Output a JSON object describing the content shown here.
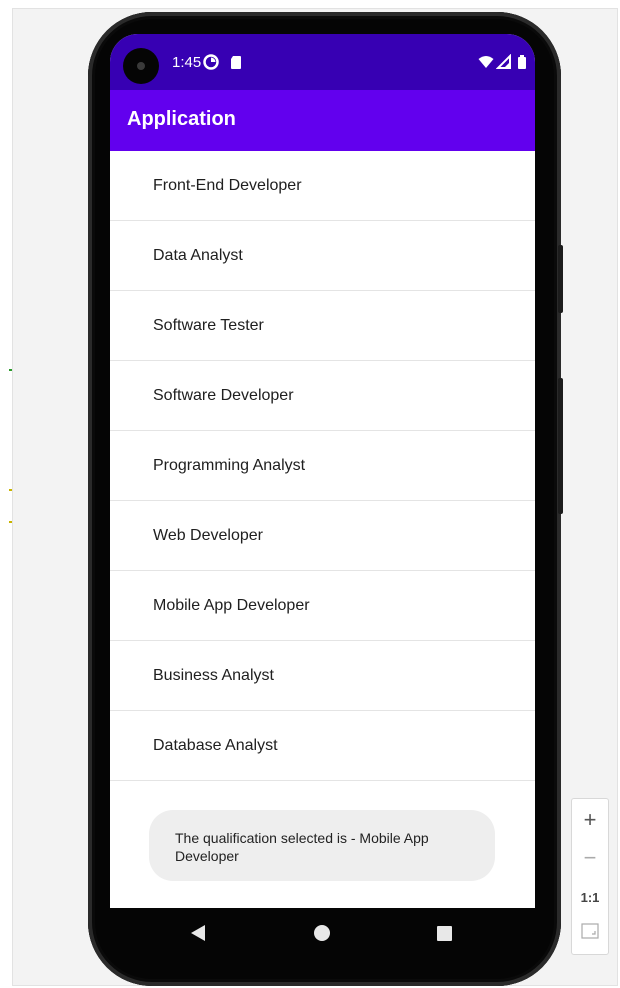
{
  "status_bar": {
    "time": "1:45",
    "icons": [
      "data-saver-icon",
      "sd-card-icon",
      "wifi-icon",
      "signal-icon",
      "battery-icon"
    ]
  },
  "app_bar": {
    "title": "Application"
  },
  "list": {
    "items": [
      "Front-End Developer",
      "Data Analyst",
      "Software Tester",
      "Software Developer",
      "Programming Analyst",
      "Web Developer",
      "Mobile App Developer",
      "Business Analyst",
      "Database Analyst"
    ]
  },
  "toast": {
    "message": "The qualification selected is - Mobile App Developer"
  },
  "nav_bar": {
    "icons": [
      "back-icon",
      "home-icon",
      "recents-icon"
    ]
  },
  "zoom_controls": {
    "zoom_in": "+",
    "zoom_out": "−",
    "actual_size": "1:1"
  },
  "colors": {
    "status_bar": "#3700b3",
    "app_bar": "#6200ee",
    "toast_bg": "#eeeeee"
  }
}
